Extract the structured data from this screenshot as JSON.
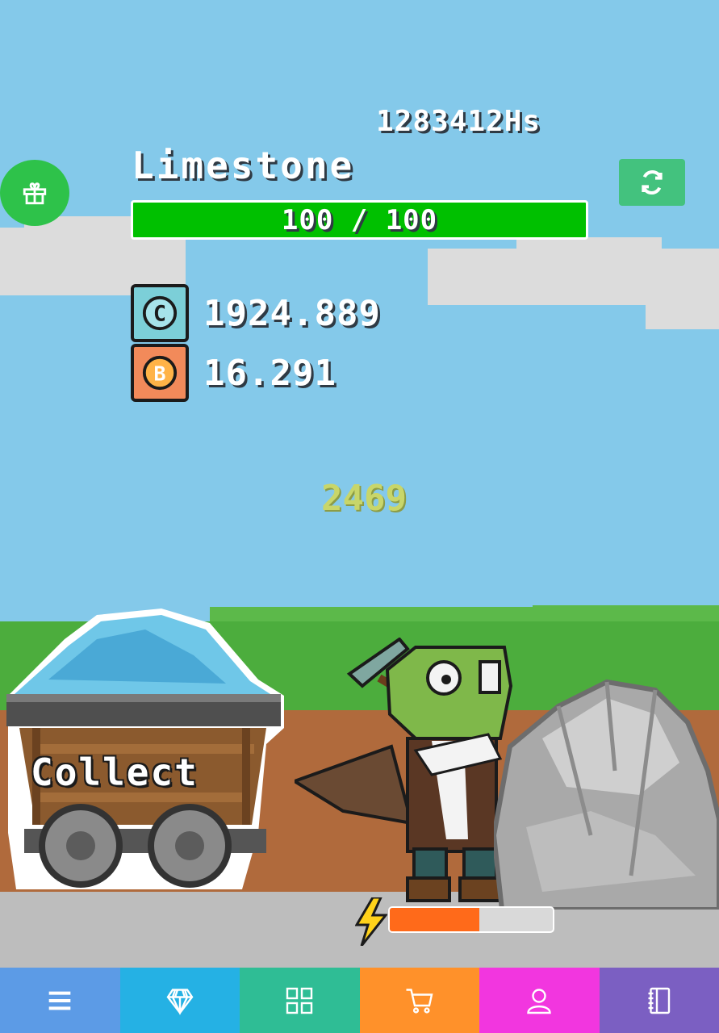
{
  "hud": {
    "hashrate": "1283412Hs",
    "ore_name": "Limestone",
    "ore_hp_text": "100 / 100",
    "ore_hp_fraction": 1.0,
    "gift_icon": "gift-icon",
    "refresh_icon": "refresh-icon"
  },
  "currencies": [
    {
      "icon": "coin-c-icon",
      "value": "1924.889",
      "color": "#7ccfd8"
    },
    {
      "icon": "bitcoin-icon",
      "value": "16.291",
      "color": "#f28a5a"
    }
  ],
  "floating_number": "2469",
  "scene": {
    "collect_label": "Collect",
    "energy_fraction": 0.55,
    "energy_color": "#ff6a1a"
  },
  "nav": [
    {
      "icon": "menu-icon",
      "color": "#5c9be6"
    },
    {
      "icon": "diamond-icon",
      "color": "#25b1e4"
    },
    {
      "icon": "grid-icon",
      "color": "#2fbd95"
    },
    {
      "icon": "cart-icon",
      "color": "#ff912a"
    },
    {
      "icon": "profile-icon",
      "color": "#f236df"
    },
    {
      "icon": "notebook-icon",
      "color": "#7b5fc2"
    }
  ]
}
